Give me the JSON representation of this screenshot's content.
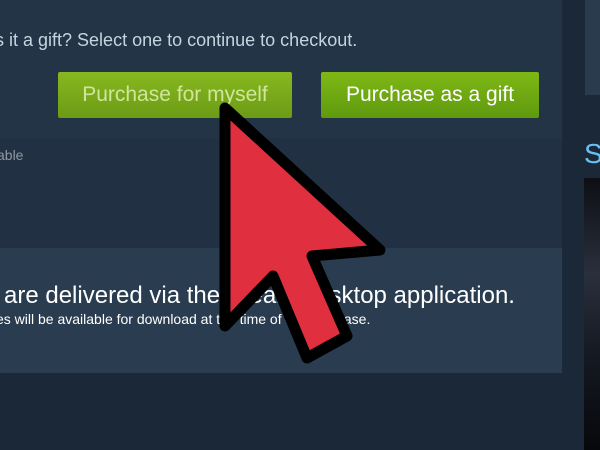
{
  "checkout": {
    "prompt": "s it a gift? Select one to continue to checkout.",
    "purchase_myself_label": "Purchase for myself",
    "purchase_gift_label": "Purchase as a gift",
    "side_note": "able"
  },
  "delivery": {
    "headline": "are delivered via the Steam desktop application.",
    "subline": "es will be available for download at the time of the purchase."
  },
  "sidebar": {
    "heading_fragment": "S"
  },
  "overlay": {
    "cursor_icon": "arrow-cursor-icon",
    "cursor_color": "#e0303f"
  },
  "colors": {
    "background": "#1b2838",
    "button_green": "#75a81a",
    "link_blue": "#67c1f5"
  }
}
